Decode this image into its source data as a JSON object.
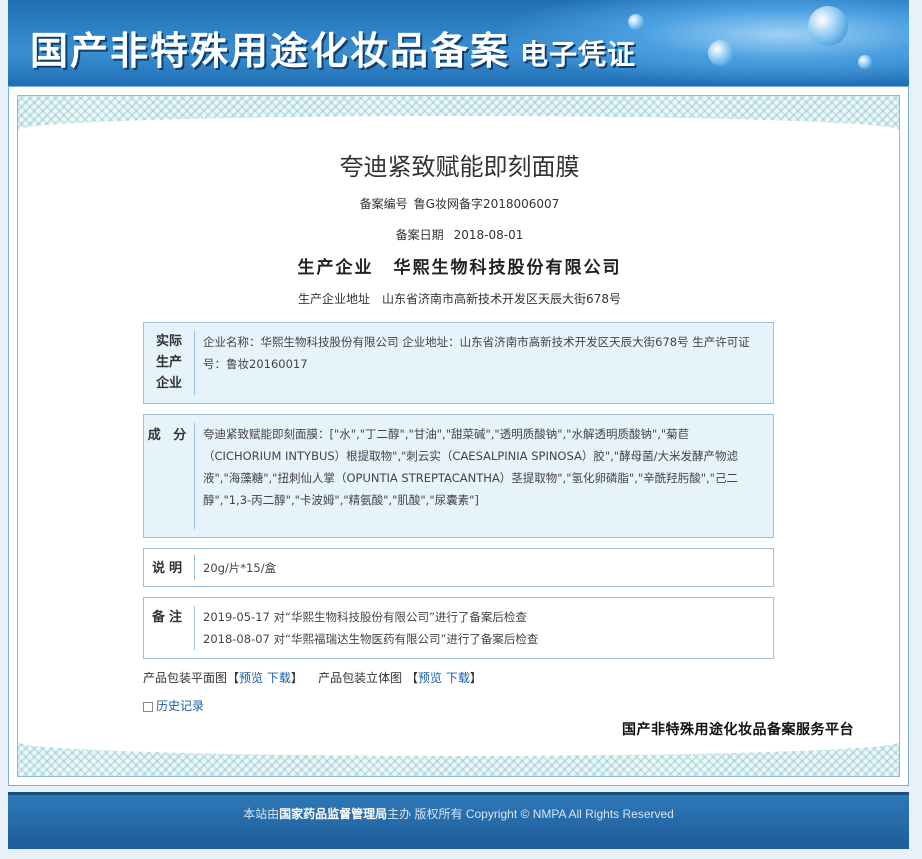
{
  "header": {
    "title": "国产非特殊用途化妆品备案",
    "subtitle": "电子凭证"
  },
  "certificate": {
    "product_name": "夸迪紧致赋能即刻面膜",
    "record_number_label": "备案编号",
    "record_number": "鲁G妆网备字2018006007",
    "record_date_label": "备案日期",
    "record_date": "2018-08-01",
    "producer_label": "生产企业",
    "producer": "华熙生物科技股份有限公司",
    "producer_address_label": "生产企业地址",
    "producer_address": "山东省济南市高新技术开发区天辰大街678号",
    "actual_producer": {
      "label": "实际生产企业",
      "content": "企业名称：华熙生物科技股份有限公司   企业地址：山东省济南市高新技术开发区天辰大街678号   生产许可证号：鲁妆20160017"
    },
    "ingredients": {
      "label": "成 分",
      "content": "夸迪紧致赋能即刻面膜：[\"水\",\"丁二醇\",\"甘油\",\"甜菜碱\",\"透明质酸钠\",\"水解透明质酸钠\",\"菊苣（CICHORIUM INTYBUS）根提取物\",\"刺云实（CAESALPINIA SPINOSA）胶\",\"酵母菌/大米发酵产物滤液\",\"海藻糖\",\"扭刺仙人掌（OPUNTIA STREPTACANTHA）茎提取物\",\"氢化卵磷脂\",\"辛酰羟肟酸\",\"己二醇\",\"1,3-丙二醇\",\"卡波姆\",\"精氨酸\",\"肌酸\",\"尿囊素\"]"
    },
    "description": {
      "label": "说明",
      "content": "20g/片*15/盒"
    },
    "remarks": {
      "label": "备注",
      "line1": "2019-05-17 对“华熙生物科技股份有限公司”进行了备案后检查",
      "line2": "2018-08-07 对“华熙福瑞达生物医药有限公司”进行了备案后检查"
    },
    "package_links": {
      "flat_label": "产品包装平面图【",
      "flat_preview": "预览",
      "flat_download": "下载",
      "flat_close": "】",
      "stereo_label": "产品包装立体图 【",
      "stereo_preview": "预览",
      "stereo_download": "下载",
      "stereo_close": "】"
    },
    "history_link": "历史记录",
    "platform_name": "国产非特殊用途化妆品备案服务平台"
  },
  "footer": {
    "prefix": "本站由",
    "org": "国家药品监督管理局",
    "suffix": "主办 版权所有 Copyright © NMPA All Rights Reserved"
  },
  "colors": {
    "header_blue": "#1f6eb3",
    "info_box_bg": "#e6f3fb",
    "link": "#1a5ea8"
  }
}
